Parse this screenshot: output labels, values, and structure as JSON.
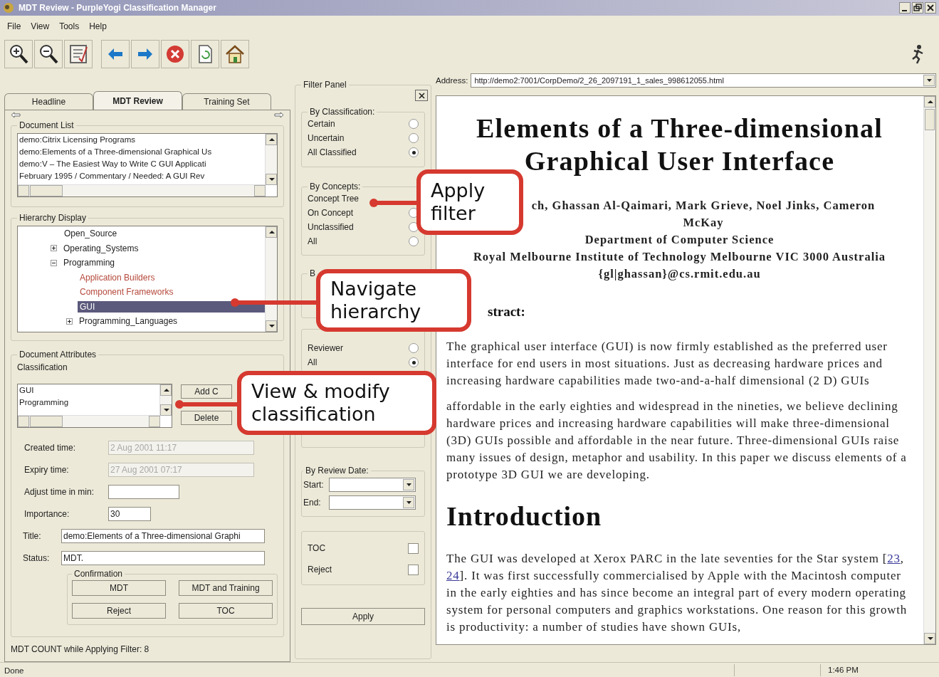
{
  "window": {
    "title": "MDT Review - PurpleYogi Classification Manager"
  },
  "menu": [
    "File",
    "View",
    "Tools",
    "Help"
  ],
  "tabs": [
    {
      "label": "Headline",
      "selected": false
    },
    {
      "label": "MDT Review",
      "selected": true
    },
    {
      "label": "Training Set",
      "selected": false
    }
  ],
  "document_list": {
    "title": "Document List",
    "items": [
      "demo:Citrix  Licensing  Programs",
      "demo:Elements of a Three-dimensional Graphical Us",
      "demo:V – The Easiest Way to Write C GUI Applicati",
      "February 1995 / Commentary / Needed: A GUI Rev"
    ]
  },
  "hierarchy": {
    "title": "Hierarchy Display",
    "items": [
      {
        "label": "Open_Source",
        "selected": false,
        "color": "#222222"
      },
      {
        "label": "Operating_Systems",
        "selected": false,
        "expanded": false,
        "color": "#222222"
      },
      {
        "label": "Programming",
        "selected": false,
        "expanded": true,
        "color": "#222222",
        "children": [
          {
            "label": "Application Builders",
            "selected": false,
            "color": "#b5483a"
          },
          {
            "label": "Component Frameworks",
            "selected": false,
            "color": "#b5483a"
          },
          {
            "label": "GUI",
            "selected": true
          },
          {
            "label": "Programming_Languages",
            "selected": false,
            "expanded": false,
            "color": "#222222"
          }
        ]
      }
    ]
  },
  "document_attributes": {
    "title": "Document Attributes",
    "classification_label": "Classification",
    "classification": [
      "GUI",
      "Programming"
    ],
    "buttons": [
      "Add C",
      "Delete"
    ],
    "fields": [
      {
        "label": "Created time:",
        "value": "2 Aug 2001 11:17",
        "disabled": true
      },
      {
        "label": "Expiry time:",
        "value": "27 Aug 2001 07:17",
        "disabled": true
      },
      {
        "label": "Adjust time in min:",
        "disabled": false
      },
      {
        "label": "Importance:",
        "value": "30",
        "disabled": false
      }
    ],
    "wide_fields": [
      {
        "label": "Title:",
        "value": "demo:Elements of a Three-dimensional Graphi"
      },
      {
        "label": "Status:",
        "value": "MDT."
      }
    ],
    "confirmation": {
      "title": "Confirmation",
      "buttons": [
        "MDT",
        "MDT and Training",
        "Reject",
        "TOC"
      ]
    },
    "count": "MDT COUNT while Applying Filter: 8"
  },
  "filter_panel": {
    "title": "Filter Panel",
    "groups": [
      {
        "kind": "radio",
        "title": "By Classification:",
        "options": [
          {
            "label": "Certain",
            "selected": false
          },
          {
            "label": "Uncertain",
            "selected": false
          },
          {
            "label": "All Classified",
            "selected": true
          }
        ]
      },
      {
        "kind": "radio",
        "title": "By Concepts:",
        "options": [
          {
            "label": "Concept Tree"
          },
          {
            "label": "On Concept",
            "selected": false
          },
          {
            "label": "Unclassified",
            "selected": false
          },
          {
            "label": "All",
            "selected": false
          }
        ]
      },
      {
        "kind": "covered",
        "title": "B"
      },
      {
        "kind": "radio",
        "options": [
          {
            "label": "Reviewer",
            "selected": false
          },
          {
            "label": "All",
            "selected": true
          }
        ]
      },
      {
        "kind": "covered"
      },
      {
        "kind": "date",
        "title": "By Review Date:",
        "fields": [
          {
            "label": "Start:"
          },
          {
            "label": "End:"
          }
        ]
      },
      {
        "kind": "check",
        "options": [
          {
            "label": "TOC",
            "checked": false
          },
          {
            "label": "Reject",
            "checked": false
          }
        ]
      }
    ],
    "apply": "Apply"
  },
  "browser": {
    "address_label": "Address:",
    "url": "http://demo2:7001/CorpDemo/2_26_2097191_1_sales_998612055.html"
  },
  "document": {
    "title": "Elements of a Three-dimensional Graphical User Interface",
    "authors": "ch, Ghassan Al-Qaimari, Mark Grieve, Noel Jinks, Cameron McKay",
    "affiliation": [
      "Department of Computer Science",
      "Royal Melbourne Institute of Technology Melbourne VIC 3000 Australia",
      "{gl|ghassan}@cs.rmit.edu.au"
    ],
    "abstract_heading": "stract:",
    "abstract": [
      "The graphical user interface (GUI) is now firmly established as the preferred user interface for end users in most situations. Just as decreasing hardware prices and increasing hardware capabilities made two-and-a-half dimensional (2 D) GUIs",
      "affordable in the early eighties and widespread in the nineties, we believe declining hardware prices and increasing hardware capabilities will make three-dimensional (3D) GUIs possible and affordable in the near future. Three-dimensional GUIs raise many issues of design, metaphor and usability. In this paper we discuss elements of a prototype 3D GUI we are developing."
    ],
    "intro_heading": "Introduction",
    "intro": [
      {
        "text": "The GUI was developed at Xerox PARC in the late seventies for the Star system ["
      },
      {
        "text": "23",
        "link": true
      },
      {
        "text": ", "
      },
      {
        "text": "24",
        "link": true
      },
      {
        "text": "]. It was first successfully commercialised by Apple with the Macintosh computer in the early eighties and has since become an integral part of every modern operating system for personal computers and graphics workstations. One reason for this growth is productivity: a number of studies have shown GUIs,"
      }
    ]
  },
  "status_bar": {
    "text": "Done",
    "time": "1:46 PM"
  },
  "callouts": [
    "Apply filter",
    "Navigate hierarchy",
    "View & modify classification"
  ]
}
